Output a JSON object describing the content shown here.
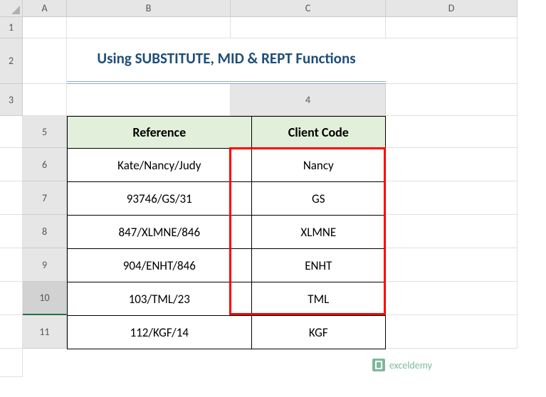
{
  "columns": [
    "A",
    "B",
    "C",
    "D"
  ],
  "rows": [
    "1",
    "2",
    "3",
    "4",
    "5",
    "6",
    "7",
    "8",
    "9",
    "10",
    "11"
  ],
  "selected_row": "10",
  "title": "Using SUBSTITUTE, MID & REPT Functions",
  "table": {
    "headers": [
      "Reference",
      "Client Code"
    ],
    "data": [
      [
        "Kate/Nancy/Judy",
        "Nancy"
      ],
      [
        "93746/GS/31",
        "GS"
      ],
      [
        "847/XLMNE/846",
        "XLMNE"
      ],
      [
        "904/ENHT/846",
        "ENHT"
      ],
      [
        "103/TML/23",
        "TML"
      ],
      [
        "112/KGF/14",
        "KGF"
      ]
    ]
  },
  "watermark": "exceldemy",
  "chart_data": {
    "type": "table",
    "title": "Using SUBSTITUTE, MID & REPT Functions",
    "headers": [
      "Reference",
      "Client Code"
    ],
    "rows": [
      {
        "Reference": "Kate/Nancy/Judy",
        "Client Code": "Nancy"
      },
      {
        "Reference": "93746/GS/31",
        "Client Code": "GS"
      },
      {
        "Reference": "847/XLMNE/846",
        "Client Code": "XLMNE"
      },
      {
        "Reference": "904/ENHT/846",
        "Client Code": "ENHT"
      },
      {
        "Reference": "103/TML/23",
        "Client Code": "TML"
      },
      {
        "Reference": "112/KGF/14",
        "Client Code": "KGF"
      }
    ]
  }
}
